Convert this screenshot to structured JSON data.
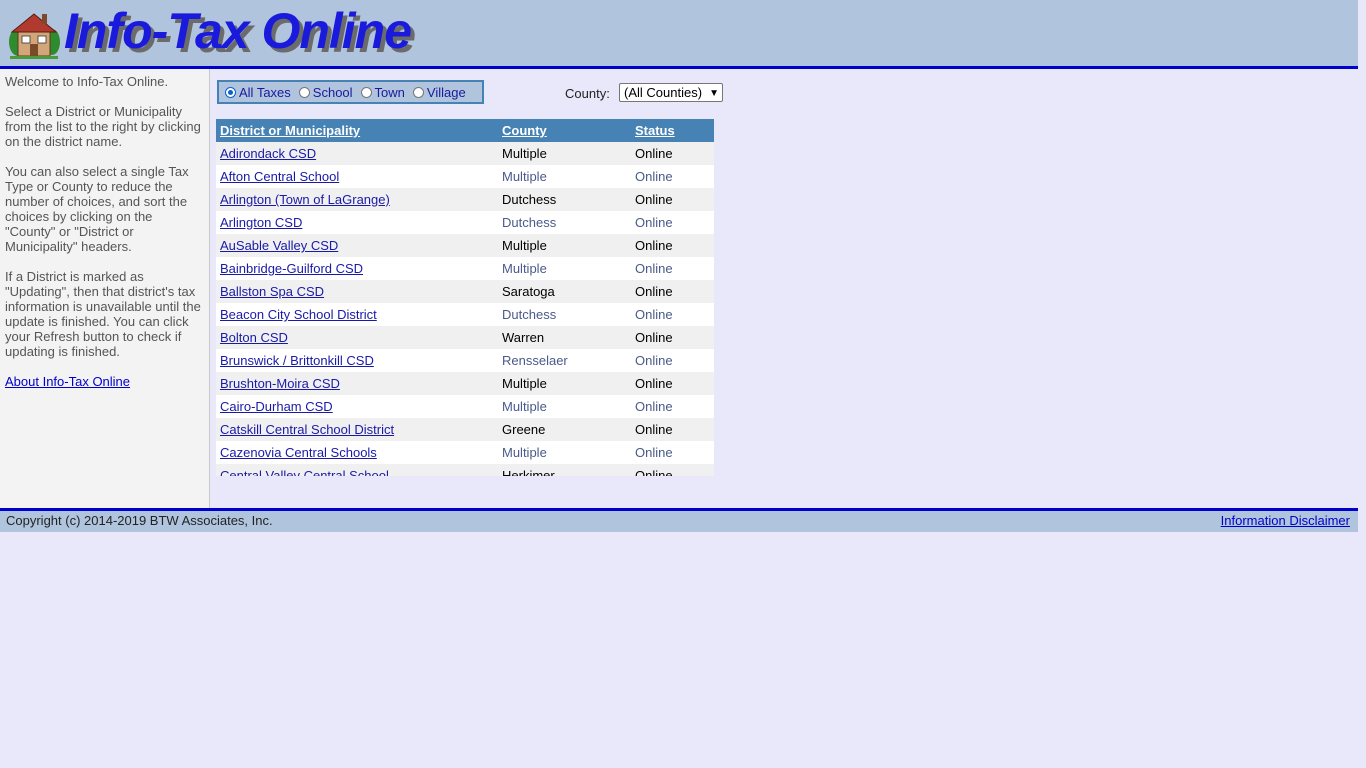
{
  "header": {
    "logo_text": "Info-Tax Online"
  },
  "sidebar": {
    "paragraphs": [
      "Welcome to Info-Tax Online.",
      "Select a District or Municipality from the list to the right by clicking on the district name.",
      "You can also select a single Tax Type or County to reduce the number of choices, and sort the choices by clicking on the \"County\" or \"District or Municipality\" headers.",
      "If a District is marked as \"Updating\", then that district's tax information is unavailable until the update is finished. You can click your Refresh button to check if updating is finished."
    ],
    "about_link": "About Info-Tax Online"
  },
  "filters": {
    "tax_types": [
      {
        "label": "All Taxes",
        "checked": true
      },
      {
        "label": "School",
        "checked": false
      },
      {
        "label": "Town",
        "checked": false
      },
      {
        "label": "Village",
        "checked": false
      }
    ],
    "county_label": "County:",
    "county_selected": "(All Counties)"
  },
  "table": {
    "headers": [
      "District or Municipality",
      "County",
      "Status"
    ],
    "rows": [
      {
        "name": "Adirondack CSD",
        "county": "Multiple",
        "status": "Online"
      },
      {
        "name": "Afton Central School",
        "county": "Multiple",
        "status": "Online"
      },
      {
        "name": "Arlington (Town of LaGrange)",
        "county": "Dutchess",
        "status": "Online"
      },
      {
        "name": "Arlington CSD",
        "county": "Dutchess",
        "status": "Online"
      },
      {
        "name": "AuSable Valley CSD",
        "county": "Multiple",
        "status": "Online"
      },
      {
        "name": "Bainbridge-Guilford CSD",
        "county": "Multiple",
        "status": "Online"
      },
      {
        "name": "Ballston Spa CSD",
        "county": "Saratoga",
        "status": "Online"
      },
      {
        "name": "Beacon City School District",
        "county": "Dutchess",
        "status": "Online"
      },
      {
        "name": "Bolton CSD",
        "county": "Warren",
        "status": "Online"
      },
      {
        "name": "Brunswick / Brittonkill CSD",
        "county": "Rensselaer",
        "status": "Online"
      },
      {
        "name": "Brushton-Moira CSD",
        "county": "Multiple",
        "status": "Online"
      },
      {
        "name": "Cairo-Durham CSD",
        "county": "Multiple",
        "status": "Online"
      },
      {
        "name": "Catskill Central School District",
        "county": "Greene",
        "status": "Online"
      },
      {
        "name": "Cazenovia Central Schools",
        "county": "Multiple",
        "status": "Online"
      },
      {
        "name": "Central Valley Central School",
        "county": "Herkimer",
        "status": "Online"
      }
    ]
  },
  "footer": {
    "copyright": "Copyright (c) 2014-2019 BTW Associates, Inc.",
    "disclaimer": "Information Disclaimer"
  },
  "colors": {
    "header_bg": "#b0c4de",
    "accent_line": "#0000cc",
    "table_header": "#4682b4",
    "page_bg": "#e9e8fb"
  }
}
